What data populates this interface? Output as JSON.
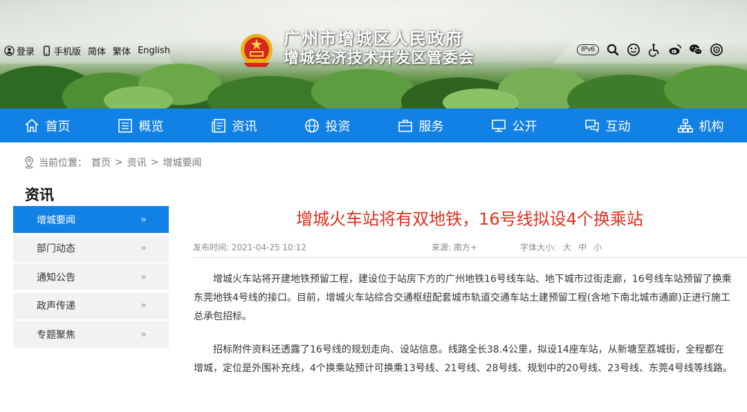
{
  "top_links": {
    "login": "登录",
    "mobile": "手机版",
    "simplified": "简体",
    "traditional": "繁体",
    "english": "English"
  },
  "site": {
    "title_line1": "广州市增城区人民政府",
    "title_line2": "增城经济技术开发区管委会"
  },
  "tools": {
    "ipv6": "IPv6",
    "icons": [
      "search-icon",
      "elder-mode-icon",
      "accessibility-icon",
      "weibo-icon",
      "wechat-icon",
      "app-icon"
    ]
  },
  "nav": [
    {
      "label": "首页",
      "icon": "home-icon"
    },
    {
      "label": "概览",
      "icon": "overview-icon"
    },
    {
      "label": "资讯",
      "icon": "news-icon"
    },
    {
      "label": "投资",
      "icon": "globe-icon"
    },
    {
      "label": "服务",
      "icon": "briefcase-icon"
    },
    {
      "label": "公开",
      "icon": "monitor-icon"
    },
    {
      "label": "互动",
      "icon": "chat-icon"
    },
    {
      "label": "机构",
      "icon": "org-icon"
    }
  ],
  "breadcrumb": {
    "prefix": "当前位置：",
    "items": [
      "首页",
      "资讯",
      "增城要闻"
    ],
    "sep": ">"
  },
  "sidebar": {
    "title": "资讯",
    "items": [
      {
        "label": "增城要闻",
        "active": true
      },
      {
        "label": "部门动态"
      },
      {
        "label": "通知公告"
      },
      {
        "label": "政声传递"
      },
      {
        "label": "专题聚焦"
      }
    ],
    "arrow": "»"
  },
  "article": {
    "title": "增城火车站将有双地铁，16号线拟设4个换乘站",
    "publish": "发布时间: 2021-04-25 10:12",
    "source": "来源: 南方+",
    "font_size_label": "字体大小:",
    "font_sizes": [
      "大",
      "中",
      "小"
    ],
    "paragraphs": [
      "增城火车站将开建地铁预留工程，建设位于站房下方的广州地铁16号线车站、地下城市过街走廊，16号线车站预留了换乘东莞地铁4号线的接口。目前，增城火车站综合交通枢纽配套城市轨道交通车站土建预留工程(含地下南北城市通廊)正进行施工总承包招标。",
      "招标附件资料还透露了16号线的规划走向、设站信息。线路全长38.4公里，拟设14座车站，从新塘至荔城街，全程都在增城，定位是外围补充线，4个换乘站预计可换乘13号线、21号线、28号线、规划中的20号线、23号线、东莞4号线等线路。"
    ]
  },
  "colors": {
    "nav_blue": "#1281e6",
    "title_red": "#e0301e"
  }
}
